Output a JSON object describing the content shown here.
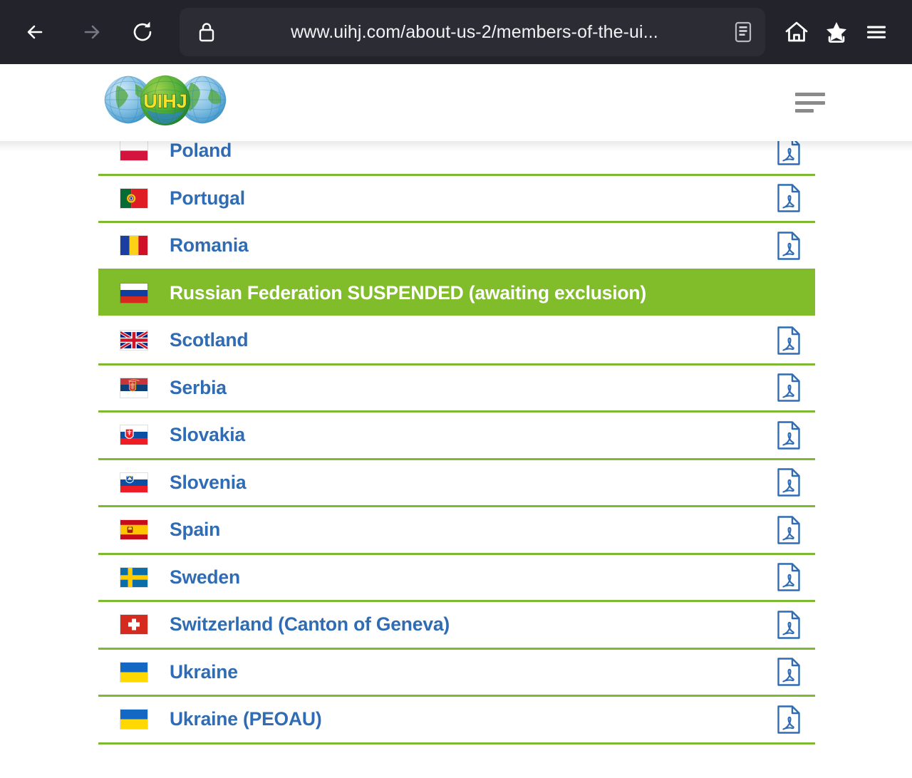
{
  "browser": {
    "back_icon": "back-arrow-icon",
    "forward_icon": "forward-arrow-icon",
    "reload_icon": "reload-icon",
    "lock_icon": "lock-icon",
    "url": "www.uihj.com/about-us-2/members-of-the-ui...",
    "reader_icon": "reader-mode-icon",
    "home_icon": "home-icon",
    "bookmark_icon": "bookmark-star-icon",
    "menu_icon": "hamburger-menu-icon",
    "toolbar_bg": "#23232b",
    "urlbar_bg": "#2c2c35"
  },
  "site": {
    "logo_text": "UIHJ",
    "logo_name": "uihj-globe-logo",
    "menu_icon": "hamburger-menu-icon"
  },
  "theme": {
    "link_blue": "#2f6cb3",
    "separator_green": "#7fb832",
    "highlight_green": "#81bc2b",
    "highlight_text": "#ffffff"
  },
  "members": [
    {
      "name": "Poland",
      "flag": "poland-flag",
      "pdf": true,
      "pdf_label": "pdf-icon",
      "highlighted": false
    },
    {
      "name": "Portugal",
      "flag": "portugal-flag",
      "pdf": true,
      "pdf_label": "pdf-icon",
      "highlighted": false
    },
    {
      "name": "Romania",
      "flag": "romania-flag",
      "pdf": true,
      "pdf_label": "pdf-icon",
      "highlighted": false
    },
    {
      "name": "Russian Federation SUSPENDED (awaiting exclusion)",
      "flag": "russia-flag",
      "pdf": false,
      "pdf_label": "",
      "highlighted": true
    },
    {
      "name": "Scotland",
      "flag": "scotland-flag",
      "pdf": true,
      "pdf_label": "pdf-icon",
      "highlighted": false
    },
    {
      "name": "Serbia",
      "flag": "serbia-flag",
      "pdf": true,
      "pdf_label": "pdf-icon",
      "highlighted": false
    },
    {
      "name": "Slovakia",
      "flag": "slovakia-flag",
      "pdf": true,
      "pdf_label": "pdf-icon",
      "highlighted": false
    },
    {
      "name": "Slovenia",
      "flag": "slovenia-flag",
      "pdf": true,
      "pdf_label": "pdf-icon",
      "highlighted": false
    },
    {
      "name": "Spain",
      "flag": "spain-flag",
      "pdf": true,
      "pdf_label": "pdf-icon",
      "highlighted": false
    },
    {
      "name": "Sweden",
      "flag": "sweden-flag",
      "pdf": true,
      "pdf_label": "pdf-icon",
      "highlighted": false
    },
    {
      "name": "Switzerland (Canton of Geneva)",
      "flag": "switzerland-flag",
      "pdf": true,
      "pdf_label": "pdf-icon",
      "highlighted": false
    },
    {
      "name": "Ukraine",
      "flag": "ukraine-flag",
      "pdf": true,
      "pdf_label": "pdf-icon",
      "highlighted": false
    },
    {
      "name": "Ukraine (PEOAU)",
      "flag": "ukraine-flag",
      "pdf": true,
      "pdf_label": "pdf-icon",
      "highlighted": false
    }
  ]
}
